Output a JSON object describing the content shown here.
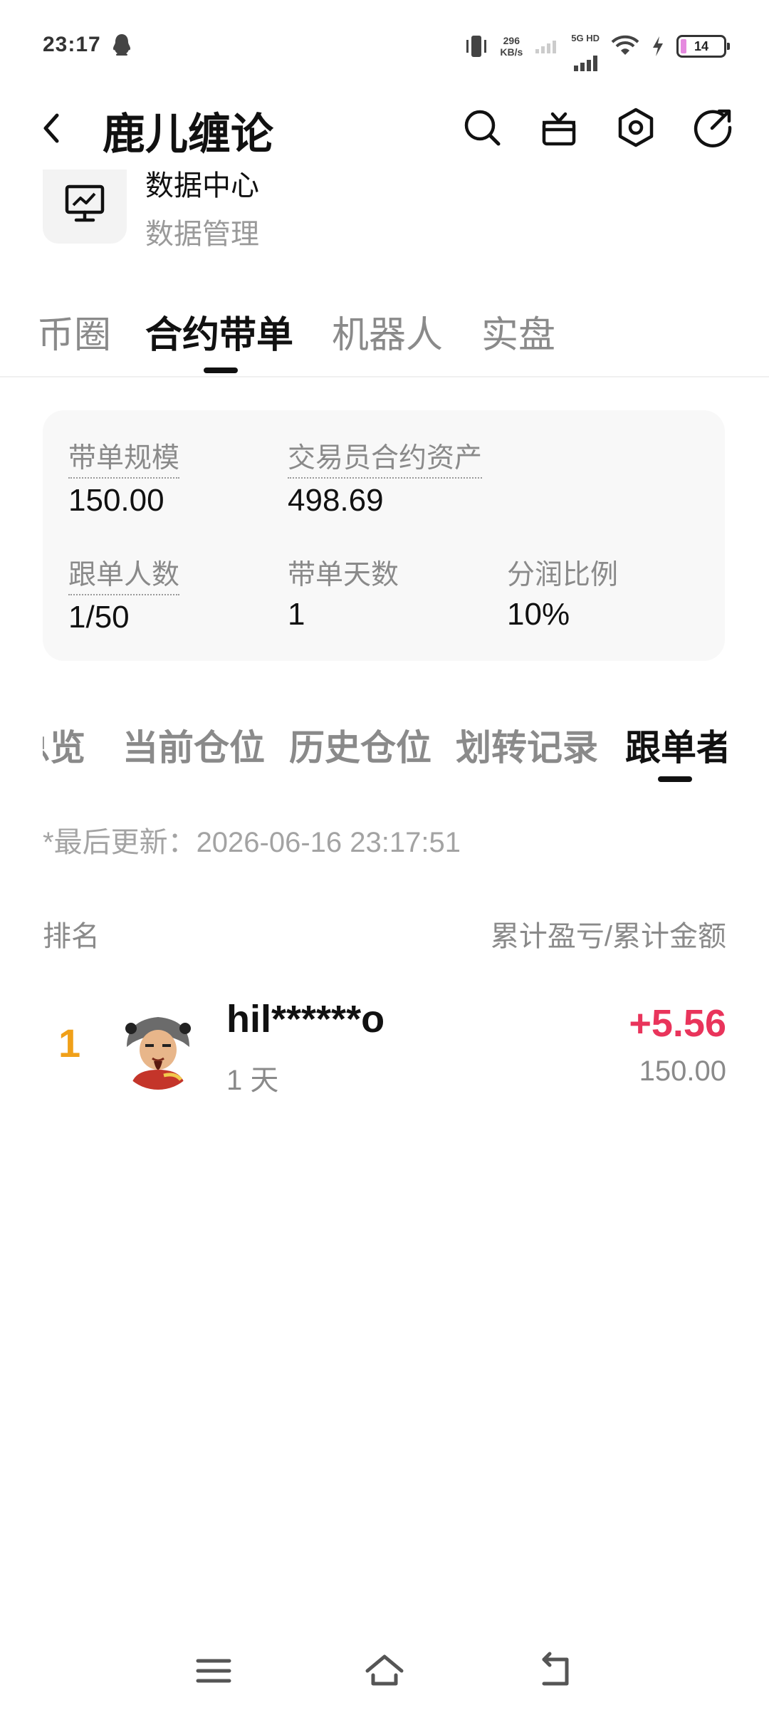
{
  "status_bar": {
    "time": "23:17",
    "net_speed_value": "296",
    "net_speed_unit": "KB/s",
    "network_type": "5G HD",
    "battery": "14"
  },
  "header": {
    "title": "鹿儿缠论",
    "icons": [
      "back-icon",
      "search-icon",
      "gift-icon",
      "settings-icon",
      "share-icon"
    ]
  },
  "data_center": {
    "title": "数据中心",
    "subtitle": "数据管理"
  },
  "top_tabs": [
    {
      "label": "币圈",
      "active": false
    },
    {
      "label": "合约带单",
      "active": true
    },
    {
      "label": "机器人",
      "active": false
    },
    {
      "label": "实盘",
      "active": false
    }
  ],
  "stats": {
    "scale_label": "带单规模",
    "scale_value": "150.00",
    "assets_label": "交易员合约资产",
    "assets_value": "498.69",
    "followers_label": "跟单人数",
    "followers_value": "1/50",
    "days_label": "带单天数",
    "days_value": "1",
    "share_label": "分润比例",
    "share_value": "10%"
  },
  "sub_tabs": [
    {
      "label": "总览",
      "active": false
    },
    {
      "label": "当前仓位",
      "active": false
    },
    {
      "label": "历史仓位",
      "active": false
    },
    {
      "label": "划转记录",
      "active": false
    },
    {
      "label": "跟单者",
      "active": true
    }
  ],
  "last_update": "*最后更新：2026-06-16 23:17:51",
  "list_header": {
    "left": "排名",
    "right": "累计盈亏/累计金额"
  },
  "followers": [
    {
      "rank": "1",
      "name": "hil******o",
      "days": "1 天",
      "pnl": "+5.56",
      "amount": "150.00"
    }
  ],
  "colors": {
    "rank": "#f0a019",
    "profit": "#e9345b",
    "card_bg": "#f8f8f8"
  }
}
